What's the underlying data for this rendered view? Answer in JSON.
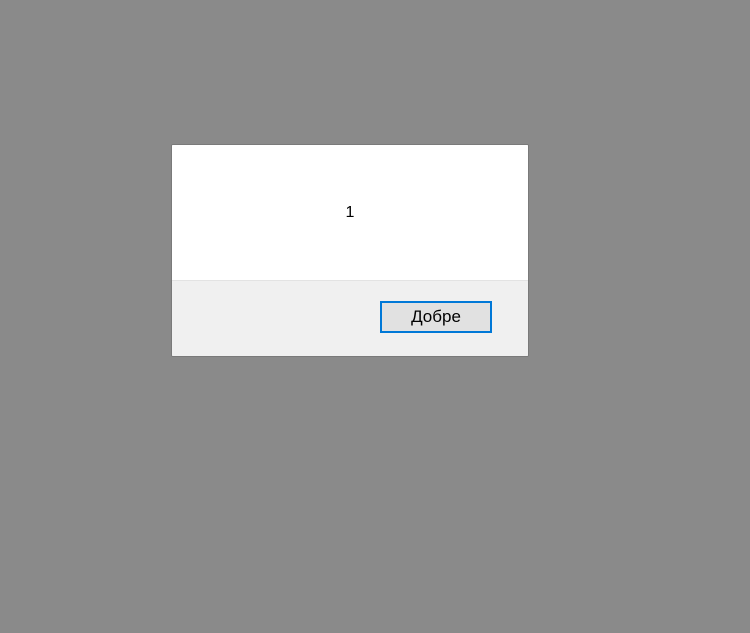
{
  "dialog": {
    "message": "1",
    "ok_label": "Добре"
  },
  "colors": {
    "overlay": "#8a8a8a",
    "dialog_body": "#ffffff",
    "dialog_footer": "#f0f0f0",
    "button_face": "#e1e1e1",
    "button_focus_border": "#0078d7"
  }
}
